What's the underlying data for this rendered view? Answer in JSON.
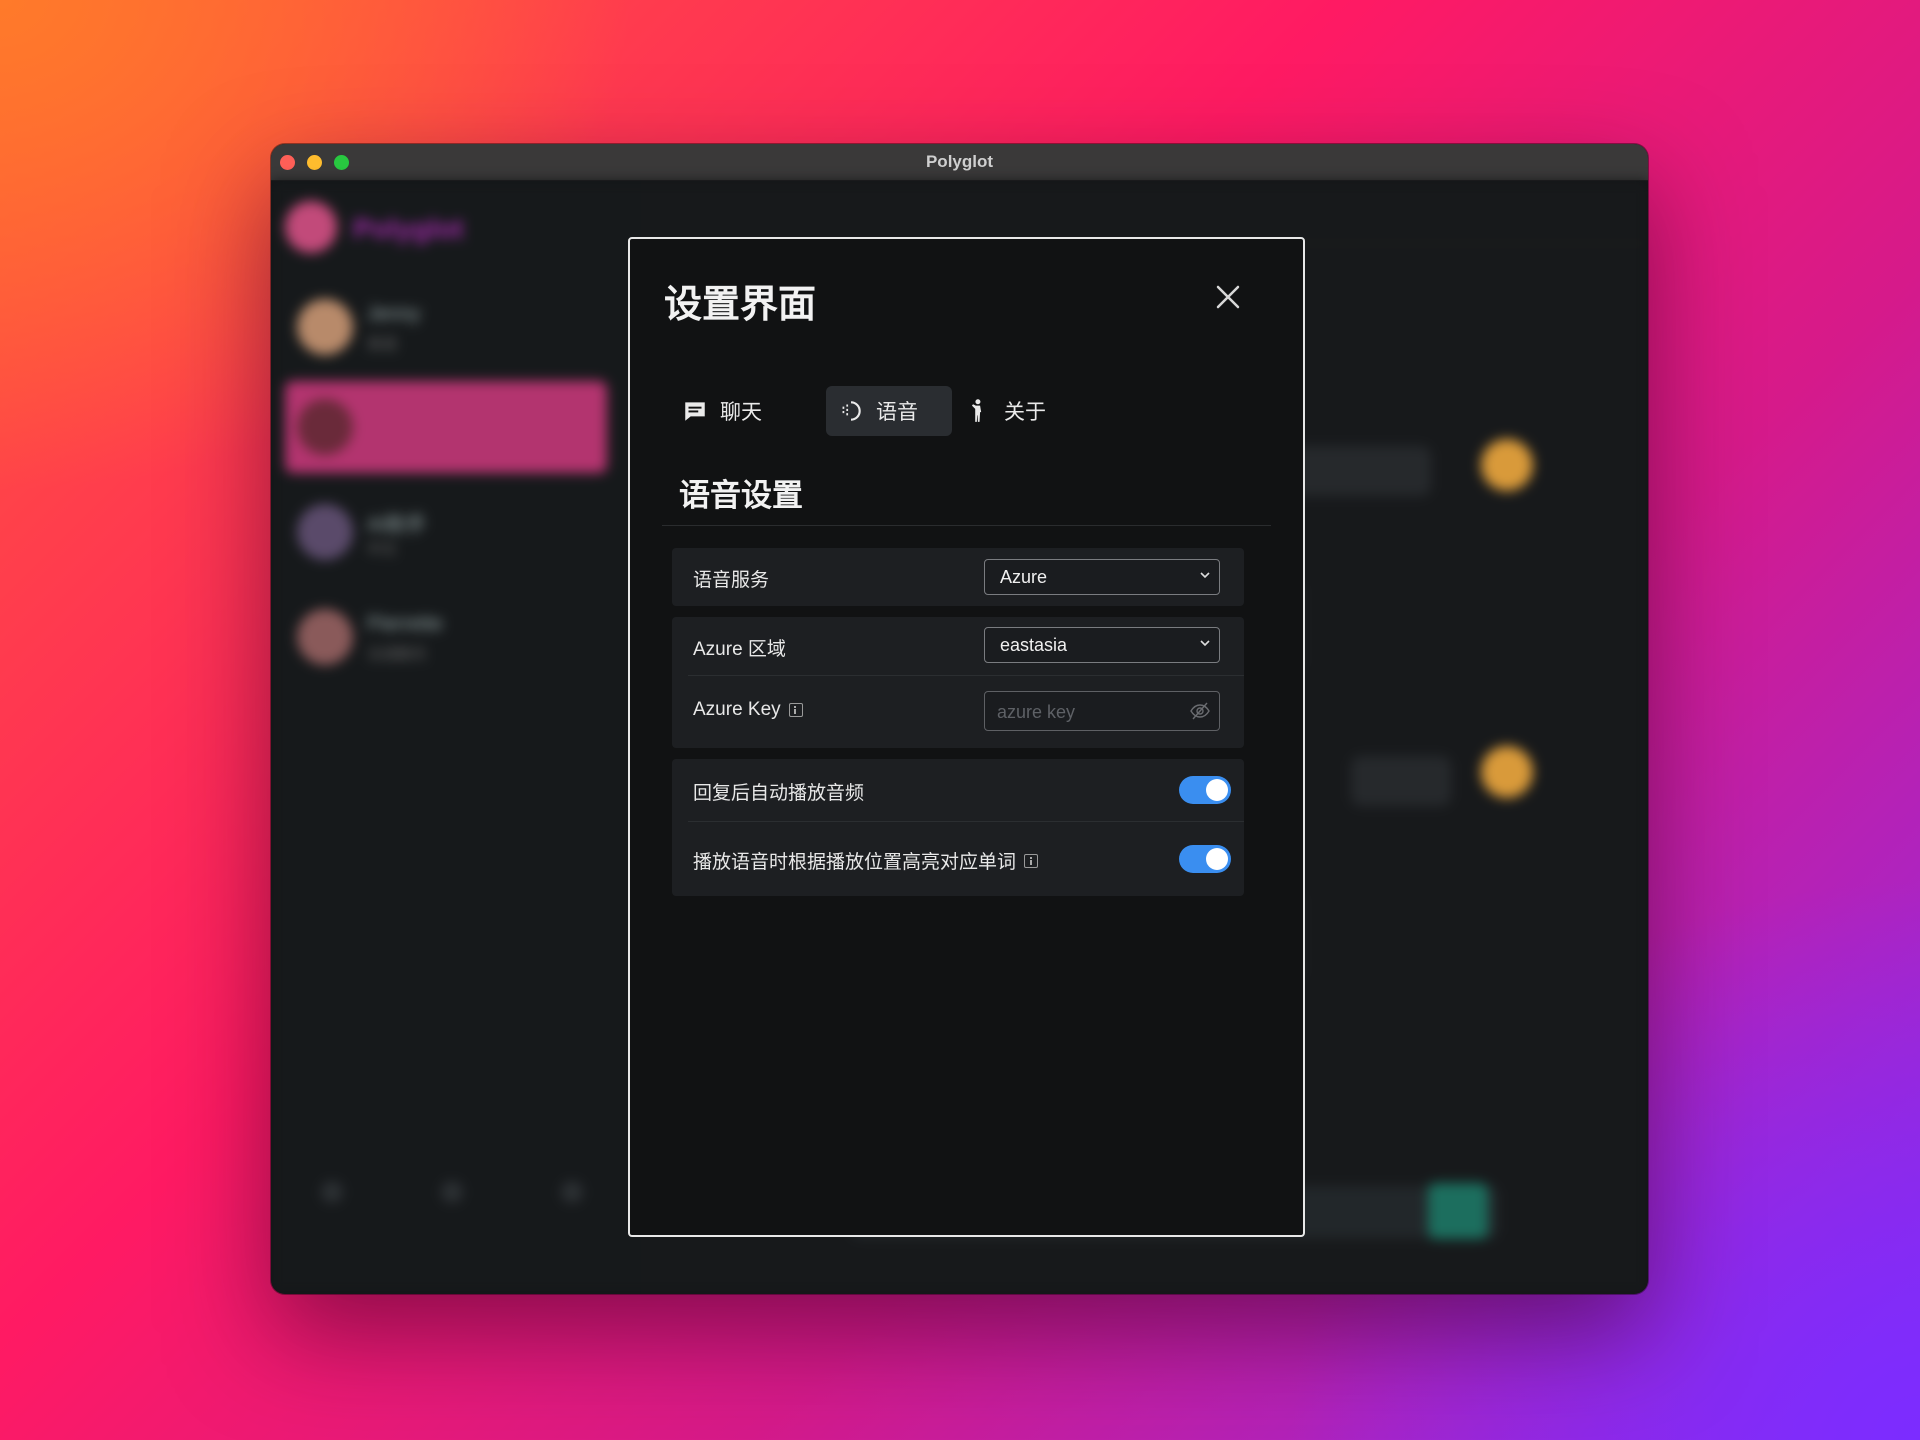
{
  "window": {
    "title": "Polyglot"
  },
  "background_app": {
    "logo_text": "Polyglot",
    "contacts": [
      {
        "name": "Jenny",
        "subtitle": "英语"
      },
      {
        "name": "",
        "subtitle": ""
      },
      {
        "name": "AI助手",
        "subtitle": "中文"
      },
      {
        "name": "Pierrette",
        "subtitle": "法语聊天"
      }
    ]
  },
  "modal": {
    "title": "设置界面",
    "tabs": [
      {
        "label": "聊天",
        "icon": "chat-bubble-icon"
      },
      {
        "label": "语音",
        "icon": "voice-wave-icon",
        "active": true
      },
      {
        "label": "关于",
        "icon": "person-icon"
      }
    ],
    "section_title": "语音设置",
    "voice_service": {
      "label": "语音服务",
      "value": "Azure"
    },
    "azure_region": {
      "label": "Azure 区域",
      "value": "eastasia"
    },
    "azure_key": {
      "label": "Azure Key",
      "placeholder": "azure key",
      "value": ""
    },
    "auto_play": {
      "label": "回复后自动播放音频",
      "enabled": true
    },
    "highlight_words": {
      "label": "播放语音时根据播放位置高亮对应单词",
      "enabled": true
    }
  },
  "colors": {
    "toggle_on": "#3a8ef0",
    "active_contact": "#b3346f",
    "modal_bg": "#111213"
  }
}
